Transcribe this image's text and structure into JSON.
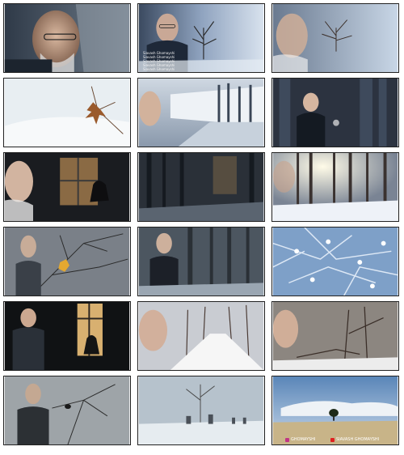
{
  "tiles": [
    {
      "id": "r0c0",
      "desc": "face"
    },
    {
      "id": "r0c1",
      "overlay_text": [
        "Siavash Ghomayshi",
        "Siavash Ghomayshi",
        "Siavash Ghomayshi",
        "Siavash Ghomayshi",
        "Siavash Ghomayshi"
      ]
    },
    {
      "id": "r0c2"
    },
    {
      "id": "r1c0"
    },
    {
      "id": "r1c1"
    },
    {
      "id": "r1c2"
    },
    {
      "id": "r2c0"
    },
    {
      "id": "r2c1"
    },
    {
      "id": "r2c2"
    },
    {
      "id": "r3c0"
    },
    {
      "id": "r3c1"
    },
    {
      "id": "r3c2"
    },
    {
      "id": "r4c0"
    },
    {
      "id": "r4c1"
    },
    {
      "id": "r4c2"
    },
    {
      "id": "r5c0"
    },
    {
      "id": "r5c1"
    },
    {
      "id": "r5c2",
      "credits": [
        "GHOMAYSHI",
        "SIAVASH GHOMAYSHI"
      ]
    }
  ],
  "colors": {
    "instagram": "#c13584",
    "youtube": "#e02020"
  }
}
